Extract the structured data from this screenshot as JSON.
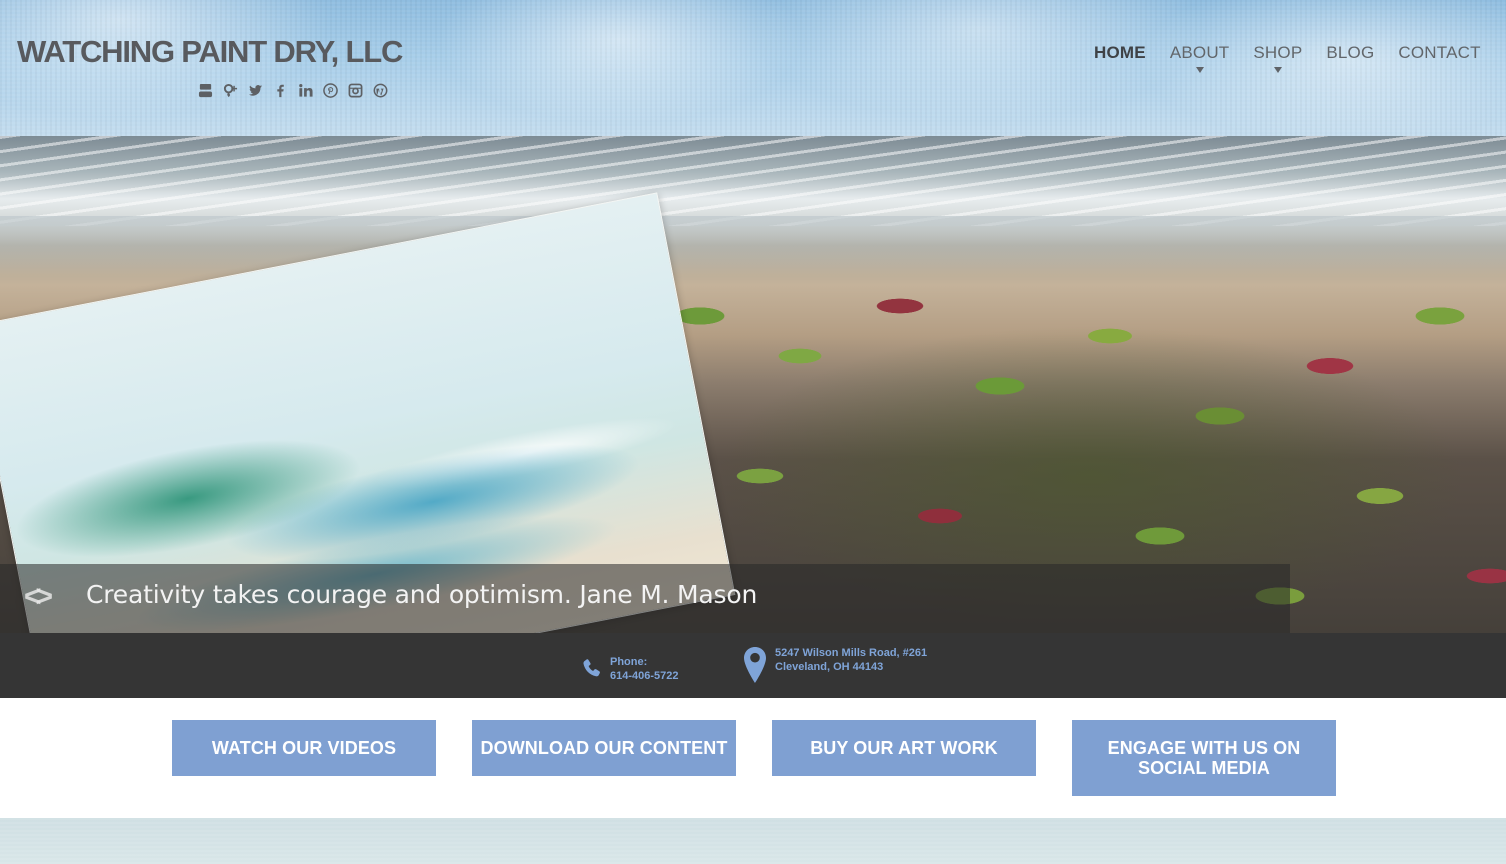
{
  "site": {
    "title": "WATCHING PAINT DRY, LLC"
  },
  "social": [
    "youtube-icon",
    "google-plus-icon",
    "twitter-icon",
    "facebook-icon",
    "linkedin-icon",
    "pinterest-icon",
    "instagram-icon",
    "wordpress-icon"
  ],
  "nav": {
    "items": [
      {
        "label": "HOME",
        "active": true,
        "dropdown": false
      },
      {
        "label": "ABOUT",
        "active": false,
        "dropdown": true
      },
      {
        "label": "SHOP",
        "active": false,
        "dropdown": true
      },
      {
        "label": "BLOG",
        "active": false,
        "dropdown": false
      },
      {
        "label": "CONTACT",
        "active": false,
        "dropdown": false
      }
    ]
  },
  "hero": {
    "caption": "Creativity takes courage and optimism. Jane M. Mason"
  },
  "contact": {
    "phone_label": "Phone:",
    "phone_number": "614-406-5722",
    "address_line1": "5247 Wilson Mills Road, #261",
    "address_line2": "Cleveland, OH 44143"
  },
  "cta": {
    "videos": "WATCH OUR VIDEOS",
    "download": "DOWNLOAD OUR CONTENT",
    "buy": "BUY OUR ART WORK",
    "engage": "ENGAGE WITH US ON SOCIAL MEDIA"
  },
  "colors": {
    "accent": "#7fa0d2",
    "contact_bar": "#353535",
    "contact_text": "#7fa4d8",
    "title_text": "#585a5e"
  }
}
